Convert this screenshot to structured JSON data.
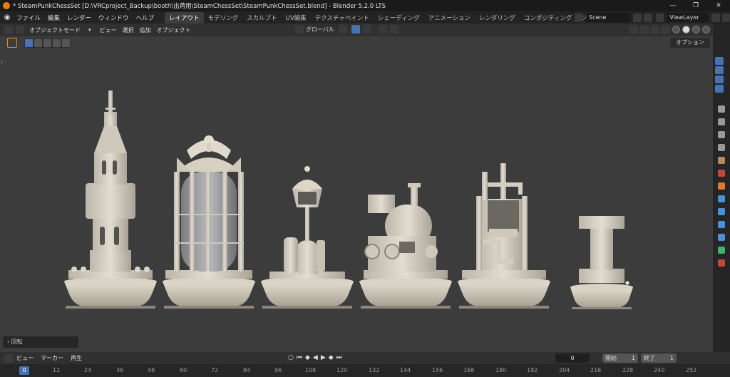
{
  "titlebar": {
    "title": "* SteamPunkChessSet [D:\\VRCproject_Backup\\booth\\出荷用\\SteamChessSet\\SteamPunkChessSet.blend] - Blender 5.2.0 LTS"
  },
  "menu": {
    "items": [
      "ファイル",
      "編集",
      "レンダー",
      "ウィンドウ",
      "ヘルプ"
    ]
  },
  "workspaces": {
    "tabs": [
      "レイアウト",
      "モデリング",
      "スカルプト",
      "UV編集",
      "テクスチャペイント",
      "シェーディング",
      "アニメーション",
      "レンダリング",
      "コンポジティング",
      "ジオメトリノ"
    ],
    "active_index": 0
  },
  "scene": {
    "name": "Scene"
  },
  "viewlayer": {
    "name": "ViewLayer"
  },
  "viewport_header": {
    "mode": "オブジェクトモード",
    "menus": [
      "ビュー",
      "選択",
      "追加",
      "オブジェクト"
    ],
    "transform_orientation": "グローバル"
  },
  "viewport": {
    "options_label": "オプション",
    "last_operator": "回転"
  },
  "timeline": {
    "menus": [
      "ビュー",
      "マーカー"
    ],
    "playback_label": "再生",
    "current_frame": "0",
    "start_label": "開始",
    "start_value": "1",
    "end_label": "終了",
    "end_value": "1",
    "ruler_ticks": [
      "12",
      "24",
      "36",
      "48",
      "60",
      "72",
      "84",
      "96",
      "108",
      "120",
      "132",
      "144",
      "156",
      "168",
      "180",
      "192",
      "204",
      "216",
      "228",
      "240",
      "252"
    ],
    "ruler_current": "0"
  },
  "colors": {
    "accent": "#4772b3",
    "viewport_bg": "#3c3c3c",
    "model": "#d8d3c6"
  }
}
